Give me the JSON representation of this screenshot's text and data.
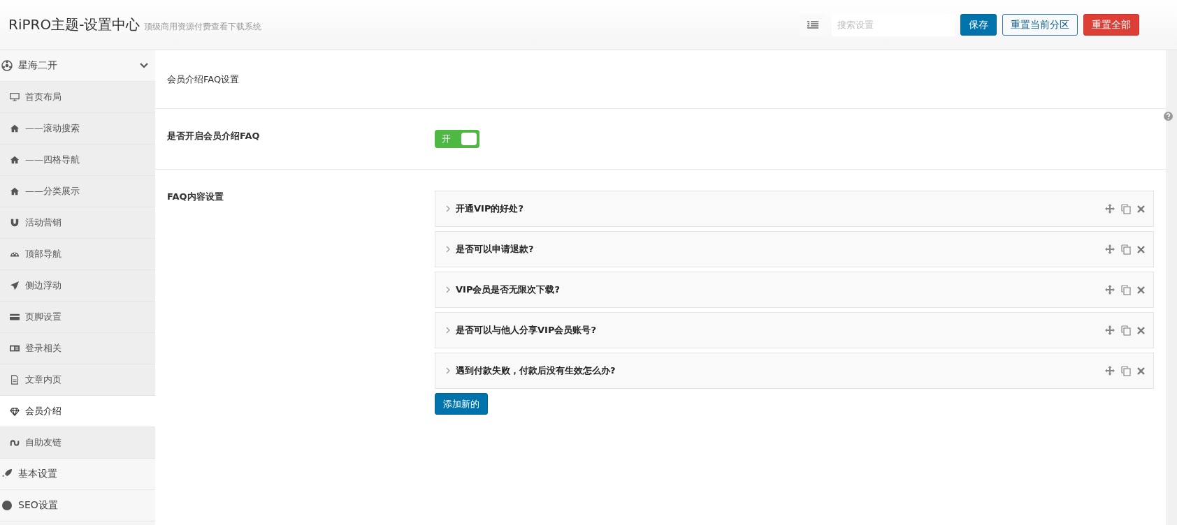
{
  "header": {
    "title": "RiPRO主题-设置中心",
    "subtitle": "顶级商用资源付费查看下载系统",
    "search": {
      "placeholder": "搜索设置"
    },
    "buttons": [
      {
        "label": "保存",
        "kind": "primary"
      },
      {
        "label": "重置当前分区",
        "kind": "outline"
      },
      {
        "label": "重置全部",
        "kind": "danger"
      }
    ]
  },
  "sidebar": {
    "items": [
      {
        "label": "星海二开",
        "expanded": true,
        "selected": false,
        "children": [
          {
            "label": "首页布局",
            "selected": false
          },
          {
            "label": "——滚动搜索",
            "selected": false
          },
          {
            "label": "——四格导航",
            "selected": false
          },
          {
            "label": "——分类展示",
            "selected": false
          },
          {
            "label": "活动营销",
            "selected": false
          },
          {
            "label": "顶部导航",
            "selected": false
          },
          {
            "label": "侧边浮动",
            "selected": false
          },
          {
            "label": "页脚设置",
            "selected": false
          },
          {
            "label": "登录相关",
            "selected": false
          },
          {
            "label": "文章内页",
            "selected": false
          },
          {
            "label": "会员介绍",
            "selected": true
          },
          {
            "label": "自助友链",
            "selected": false
          }
        ]
      },
      {
        "label": "基本设置",
        "selected": false
      },
      {
        "label": "SEO设置",
        "selected": false
      }
    ]
  },
  "content": {
    "section_title": "会员介绍FAQ设置",
    "toggle_field": {
      "label": "是否开启会员介绍FAQ",
      "on": true,
      "on_text": "开"
    },
    "faq_field": {
      "label": "FAQ内容设置",
      "items": [
        {
          "title": "开通VIP的好处?"
        },
        {
          "title": "是否可以申请退款?"
        },
        {
          "title": "VIP会员是否无限次下载?"
        },
        {
          "title": "是否可以与他人分享VIP会员账号?"
        },
        {
          "title": "遇到付款失败，付款后没有生效怎么办?"
        }
      ],
      "add_button": "添加新的"
    }
  }
}
